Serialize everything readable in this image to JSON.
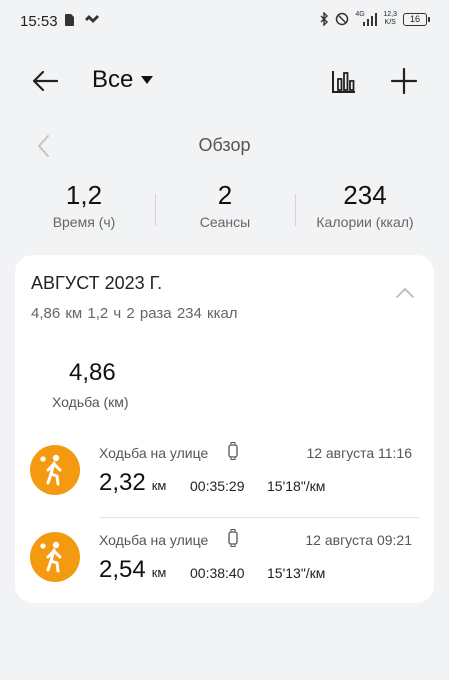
{
  "status_bar": {
    "time": "15:53",
    "network": "4G",
    "net_speed_value": "12,3",
    "net_speed_unit": "K/S",
    "battery": "16"
  },
  "header": {
    "filter_label": "Все"
  },
  "overview": {
    "title": "Обзор"
  },
  "summary": [
    {
      "value": "1,2",
      "label": "Время (ч)"
    },
    {
      "value": "2",
      "label": "Сеансы"
    },
    {
      "value": "234",
      "label": "Калории (ккал)"
    }
  ],
  "month_card": {
    "title": "АВГУСТ 2023 Г.",
    "stats": "4,86 км  1,2 ч  2 раза  234 ккал",
    "distance_value": "4,86",
    "distance_label": "Ходьба (км)",
    "workouts": [
      {
        "name": "Ходьба на улице",
        "date": "12 августа 11:16",
        "distance": "2,32",
        "unit": "км",
        "duration": "00:35:29",
        "pace": "15'18\"/км"
      },
      {
        "name": "Ходьба на улице",
        "date": "12 августа 09:21",
        "distance": "2,54",
        "unit": "км",
        "duration": "00:38:40",
        "pace": "15'13\"/км"
      }
    ]
  },
  "colors": {
    "background": "#f1f3f5",
    "card": "#ffffff",
    "activity_accent": "#f39a11"
  },
  "icons": {
    "back": "arrow-left-icon",
    "chart": "bar-chart-icon",
    "add": "plus-icon",
    "prev": "chevron-left-icon",
    "collapse": "chevron-up-icon",
    "activity": "walking-person-icon",
    "device": "watch-icon"
  }
}
